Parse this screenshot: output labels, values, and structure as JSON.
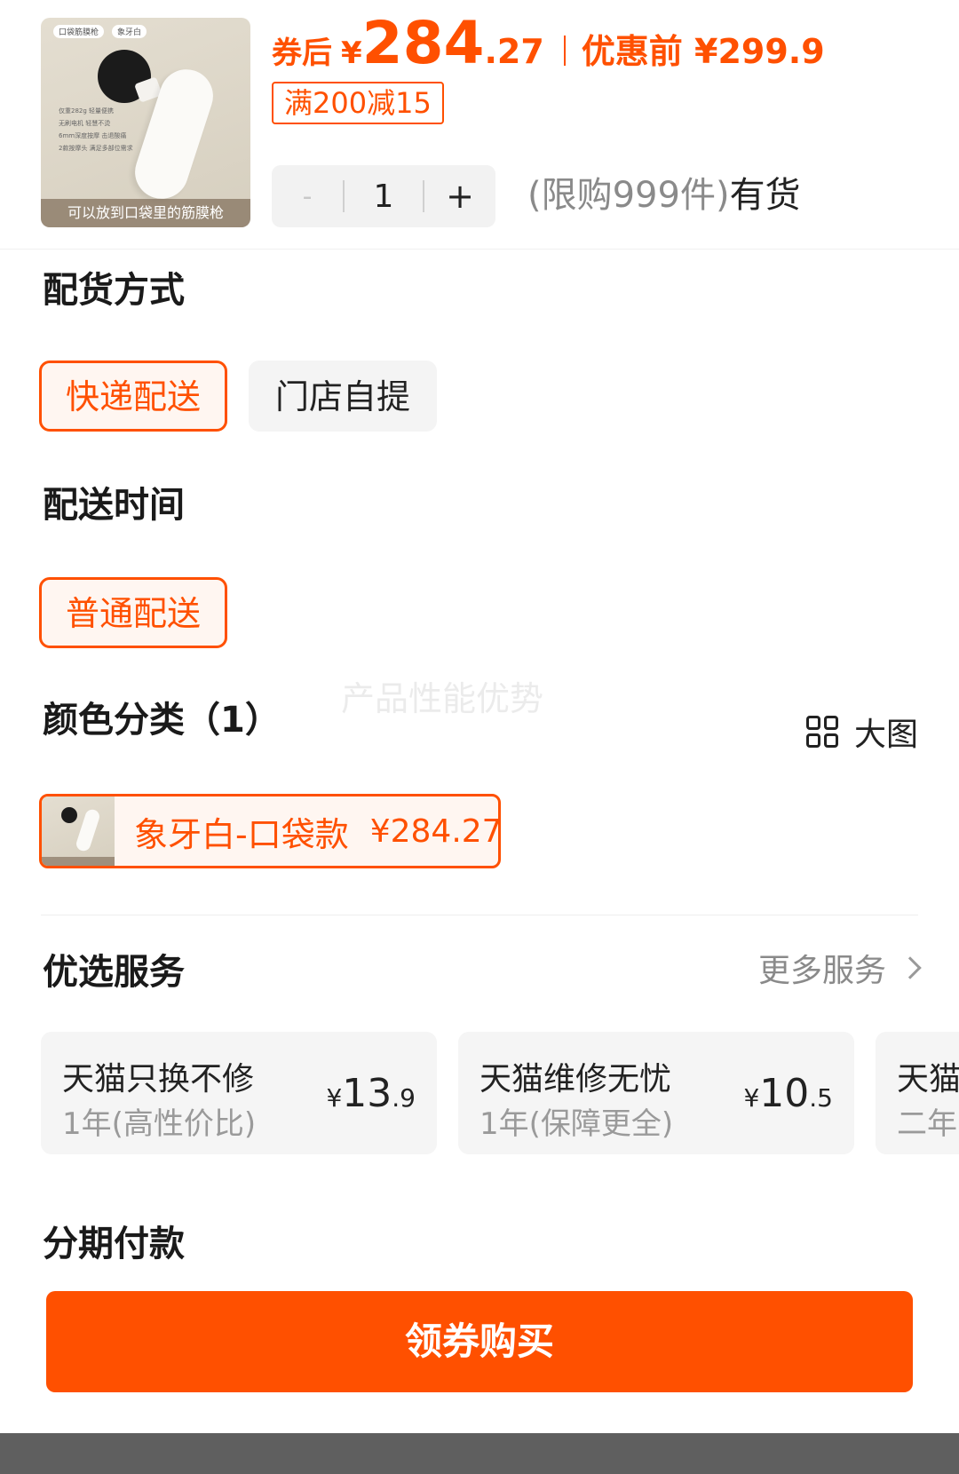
{
  "product": {
    "thumb_tag_1": "口袋筋膜枪",
    "thumb_tag_2": "象牙白",
    "thumb_lines": [
      "仅重282g 轻量便携",
      "无刷电机 轻慧不烫",
      "6mm深度按摩 击退酸痛",
      "2款按摩头 满足多部位需求"
    ],
    "thumb_caption": "可以放到口袋里的筋膜枪",
    "price_prefix": "券后",
    "price_yen": "¥",
    "price_int": "284",
    "price_dec": ".27",
    "orig_price": "优惠前 ¥299.9",
    "coupon": "满200减15",
    "stepper": {
      "minus": "-",
      "value": "1",
      "plus": "+"
    },
    "stock_limit": "(限购999件)",
    "stock_status": "有货"
  },
  "delivery_method": {
    "title": "配货方式",
    "options": [
      {
        "label": "快递配送",
        "selected": true
      },
      {
        "label": "门店自提",
        "selected": false
      }
    ]
  },
  "delivery_time": {
    "title": "配送时间",
    "options": [
      {
        "label": "普通配送",
        "selected": true
      }
    ]
  },
  "watermark": "产品性能优势",
  "color": {
    "title": "颜色分类（1）",
    "big_image_label": "大图",
    "big_image_icon": "grid-icon",
    "variants": [
      {
        "label": "象牙白-口袋款",
        "price": "¥284.27",
        "selected": true
      }
    ]
  },
  "services": {
    "title": "优选服务",
    "more_label": "更多服务",
    "items": [
      {
        "name": "天猫只换不修",
        "term": "1年(高性价比)",
        "yen": "¥",
        "int": "13",
        "dec": ".9"
      },
      {
        "name": "天猫维修无忧",
        "term": "1年(保障更全)",
        "yen": "¥",
        "int": "10",
        "dec": ".5"
      },
      {
        "name": "天猫",
        "term": "二年(",
        "yen": "",
        "int": "",
        "dec": ""
      }
    ]
  },
  "installment": {
    "title": "分期付款"
  },
  "buy_button": "领券购买",
  "colors": {
    "accent": "#ff5000",
    "accent_bg": "#fff6f1",
    "option_bg": "#f4f4f4",
    "bottom_bar": "#5f5f5f"
  }
}
